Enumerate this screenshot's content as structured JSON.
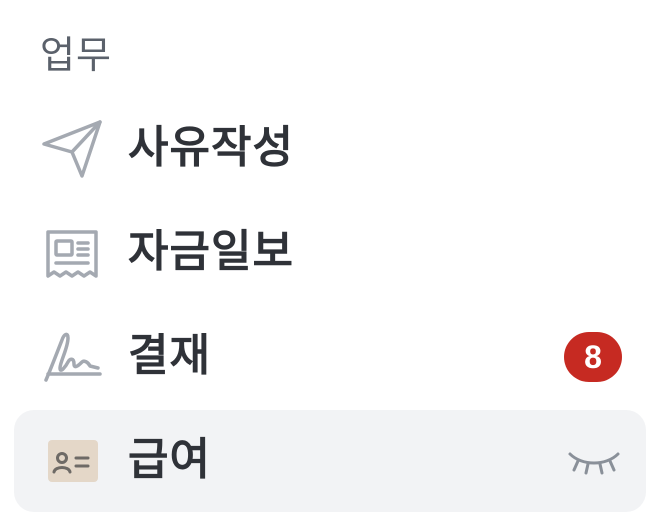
{
  "section": {
    "title": "업무"
  },
  "menu": {
    "items": [
      {
        "label": "사유작성",
        "icon": "send-icon"
      },
      {
        "label": "자금일보",
        "icon": "receipt-icon"
      },
      {
        "label": "결재",
        "icon": "signature-icon",
        "badge": "8"
      },
      {
        "label": "급여",
        "icon": "id-card-icon",
        "trailing_icon": "eye-closed-icon",
        "active": true
      }
    ]
  },
  "colors": {
    "badge": "#c62a22",
    "active_background": "#f2f3f5",
    "icon_stroke": "#a4a9b1",
    "id_card_fill": "#e4d7c8"
  }
}
